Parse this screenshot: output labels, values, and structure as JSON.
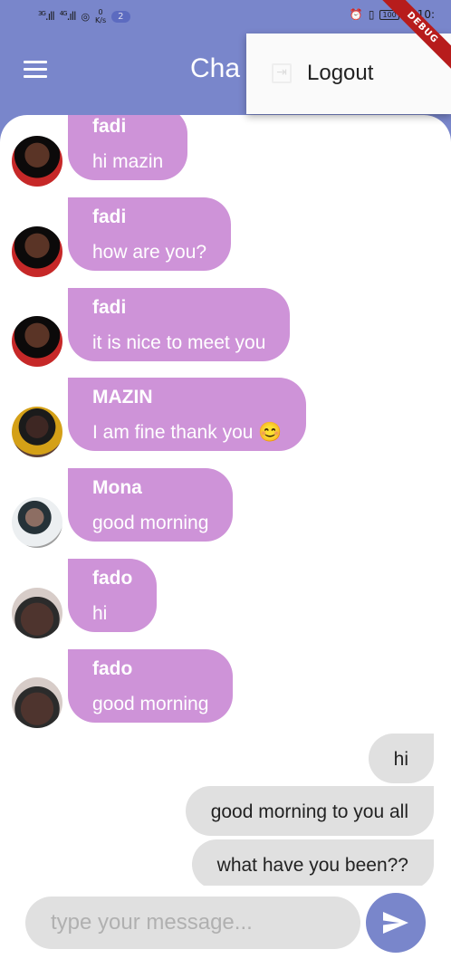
{
  "status_bar": {
    "network_left": "3G",
    "network_right": "4G",
    "speed_value": "0",
    "speed_unit": "K/s",
    "notification_count": "2",
    "battery": "100",
    "time": "10:"
  },
  "debug_banner": "DEBUG",
  "app_bar": {
    "title": "Cha"
  },
  "menu": {
    "logout_label": "Logout"
  },
  "received_messages": [
    {
      "sender": "fadi",
      "text": "hi mazin",
      "avatar": "fadi-avatar"
    },
    {
      "sender": "fadi",
      "text": "how are you?",
      "avatar": "fadi-avatar"
    },
    {
      "sender": "fadi",
      "text": "it is nice to meet you",
      "avatar": "fadi-avatar"
    },
    {
      "sender": "MAZIN",
      "text": "I am fine thank you 😊",
      "avatar": "mazin-avatar"
    },
    {
      "sender": "Mona",
      "text": "good morning",
      "avatar": "mona-avatar"
    },
    {
      "sender": "fado",
      "text": "hi",
      "avatar": "fado-avatar"
    },
    {
      "sender": "fado",
      "text": "good morning",
      "avatar": "fado-avatar"
    }
  ],
  "sent_messages": [
    {
      "text": "hi"
    },
    {
      "text": "good morning to you all"
    },
    {
      "text": "what have you been??"
    }
  ],
  "composer": {
    "placeholder": "type your message..."
  },
  "colors": {
    "primary": "#7986cb",
    "received_bubble": "#ce93d8",
    "sent_bubble": "#e0e0e0"
  }
}
